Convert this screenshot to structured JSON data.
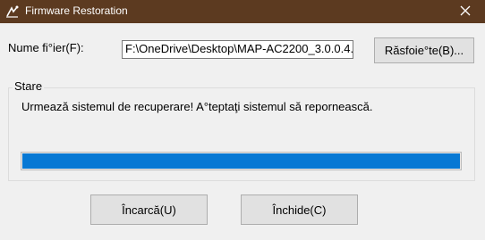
{
  "window": {
    "title": "Firmware Restoration",
    "close_icon": "close-icon",
    "app_icon": "asus-router-icon",
    "titlebar_color": "#5c3a20"
  },
  "file": {
    "label": "Nume fi°ier(F):",
    "value": "F:\\OneDrive\\Desktop\\MAP-AC2200_3.0.0.4.",
    "browse_label": "Răsfoie°te(B)..."
  },
  "status": {
    "legend": "Stare",
    "message": "Urmează sistemul de recuperare! A°teptaţi sistemul să repornească.",
    "progress_percent": 100,
    "progress_color": "#0678d4"
  },
  "buttons": {
    "upload_label": "Încarcă(U)",
    "close_label": "Închide(C)"
  }
}
